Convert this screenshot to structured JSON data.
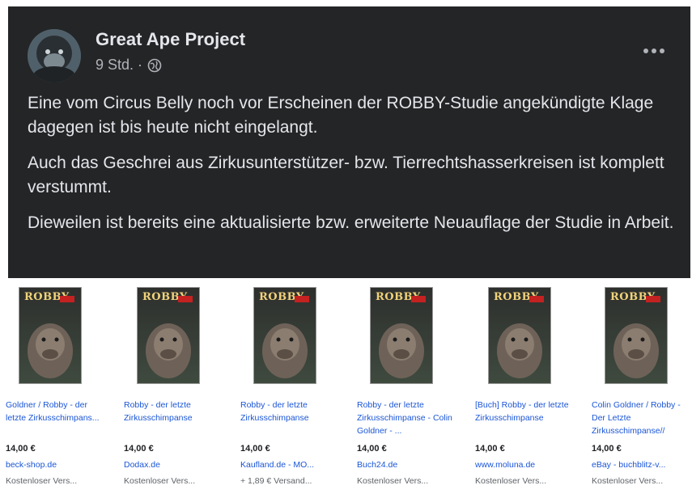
{
  "post": {
    "author": "Great Ape Project",
    "time": "9 Std. ·",
    "paragraphs": [
      "Eine vom Circus Belly noch vor Erscheinen der ROBBY-Studie angekündigte Klage dagegen ist bis heute nicht eingelangt.",
      "Auch das Geschrei aus Zirkusunterstützer- bzw. Tierrechtshasserkreisen ist komplett verstummt.",
      "Dieweilen ist bereits eine aktualisierte bzw. erweiterte Neuauflage der Studie in Arbeit."
    ]
  },
  "products": [
    {
      "cover_title": "ROBBY",
      "title": "Goldner / Robby - der letzte Zirkusschimpans...",
      "price": "14,00 €",
      "shop": "beck-shop.de",
      "shipping": "Kostenloser Vers..."
    },
    {
      "cover_title": "ROBBY",
      "title": "Robby - der letzte Zirkusschimpanse",
      "price": "14,00 €",
      "shop": "Dodax.de",
      "shipping": "Kostenloser Vers..."
    },
    {
      "cover_title": "ROBBY",
      "title": "Robby - der letzte Zirkusschimpanse",
      "price": "14,00 €",
      "shop": "Kaufland.de - MO...",
      "shipping": "+ 1,89 € Versand..."
    },
    {
      "cover_title": "ROBBY",
      "title": "Robby - der letzte Zirkusschimpanse - Colin Goldner - ...",
      "price": "14,00 €",
      "shop": "Buch24.de",
      "shipping": "Kostenloser Vers..."
    },
    {
      "cover_title": "ROBBY",
      "title": "[Buch] Robby - der letzte Zirkusschimpanse",
      "price": "14,00 €",
      "shop": "www.moluna.de",
      "shipping": "Kostenloser Vers..."
    },
    {
      "cover_title": "ROBBY",
      "title": "Colin Goldner / Robby - Der Letzte Zirkusschimpanse//",
      "price": "14,00 €",
      "shop": "eBay - buchblitz-v...",
      "shipping": "Kostenloser Vers..."
    }
  ]
}
